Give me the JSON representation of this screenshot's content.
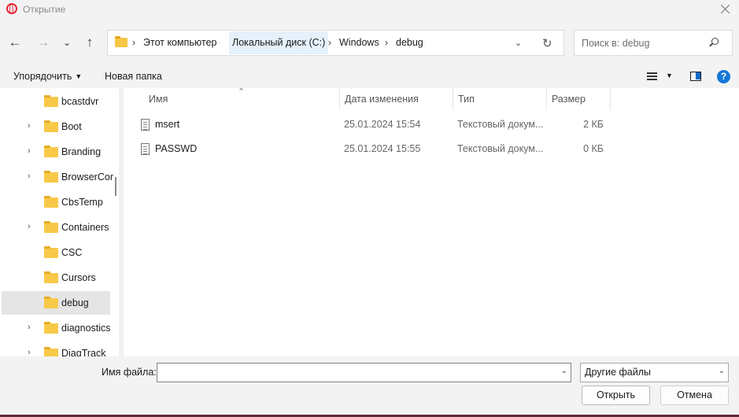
{
  "window": {
    "title": "Открытие"
  },
  "address": {
    "crumbs": [
      "Этот компьютер",
      "Локальный диск (C:)",
      "Windows",
      "debug"
    ],
    "separator": "›",
    "search_placeholder": "Поиск в: debug"
  },
  "toolbar": {
    "organize_label": "Упорядочить",
    "new_folder_label": "Новая папка",
    "help_label": "?"
  },
  "nav": {
    "items": [
      {
        "label": "bcastdvr",
        "expandable": false
      },
      {
        "label": "Boot",
        "expandable": true
      },
      {
        "label": "Branding",
        "expandable": true
      },
      {
        "label": "BrowserCor",
        "expandable": true
      },
      {
        "label": "CbsTemp",
        "expandable": false
      },
      {
        "label": "Containers",
        "expandable": true
      },
      {
        "label": "CSC",
        "expandable": false
      },
      {
        "label": "Cursors",
        "expandable": false
      },
      {
        "label": "debug",
        "expandable": false,
        "selected": true
      },
      {
        "label": "diagnostics",
        "expandable": true
      },
      {
        "label": "DiagTrack",
        "expandable": true
      }
    ]
  },
  "filelist": {
    "columns": [
      "Имя",
      "Дата изменения",
      "Тип",
      "Размер"
    ],
    "rows": [
      {
        "name": "msert",
        "date": "25.01.2024 15:54",
        "type": "Текстовый докум...",
        "size": "2 КБ"
      },
      {
        "name": "PASSWD",
        "date": "25.01.2024 15:55",
        "type": "Текстовый докум...",
        "size": "0 КБ"
      }
    ]
  },
  "bottom": {
    "filename_label": "Имя файла:",
    "filename_value": "",
    "filter_value": "Другие файлы",
    "open_label": "Открыть",
    "cancel_label": "Отмена"
  },
  "colors": {
    "accent": "#0c6ac8",
    "folder": "#f8c948",
    "selection": "#e5e5e5",
    "crumb_highlight": "#e5f1fb"
  }
}
